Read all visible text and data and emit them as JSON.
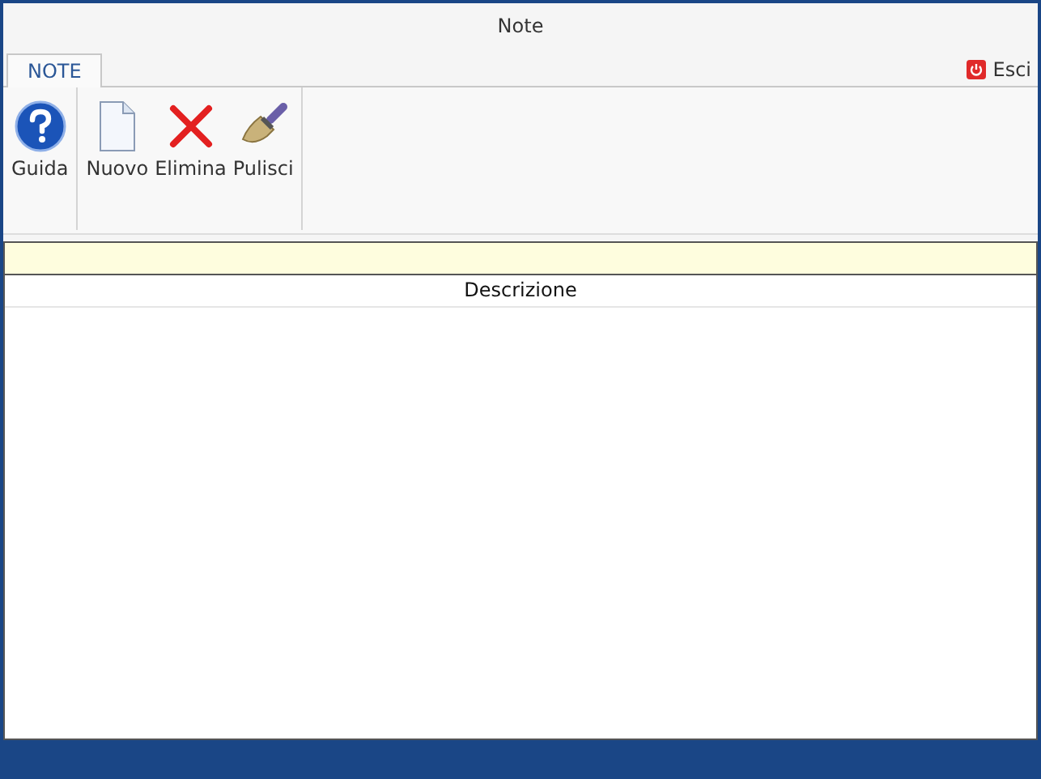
{
  "window": {
    "title": "Note"
  },
  "tabs": [
    {
      "label": "NOTE",
      "selected": true
    }
  ],
  "exit_button": {
    "label": "Esci"
  },
  "ribbon_groups": [
    {
      "buttons": [
        {
          "kind": "help",
          "label": "Guida"
        }
      ]
    },
    {
      "buttons": [
        {
          "kind": "new",
          "label": "Nuovo"
        },
        {
          "kind": "delete",
          "label": "Elimina"
        },
        {
          "kind": "clear",
          "label": "Pulisci"
        }
      ]
    }
  ],
  "table": {
    "columns": [
      "Descrizione"
    ]
  }
}
